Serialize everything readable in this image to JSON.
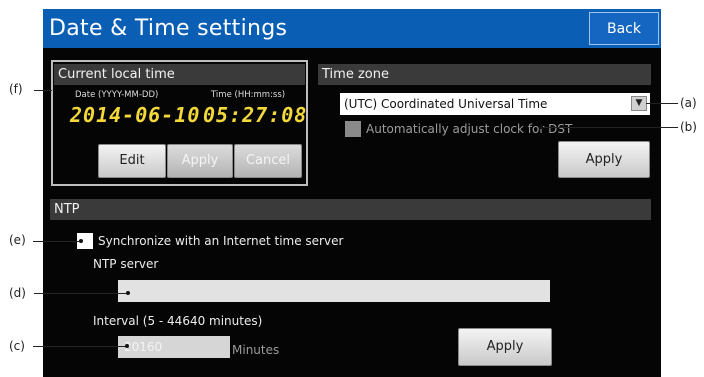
{
  "header": {
    "title": "Date & Time settings",
    "back_label": "Back"
  },
  "current_time": {
    "heading": "Current local time",
    "date_label": "Date (YYYY-MM-DD)",
    "time_label": "Time (HH:mm:ss)",
    "date_value": "2014-06-10",
    "time_value": "05:27:08",
    "edit_label": "Edit",
    "apply_label": "Apply",
    "cancel_label": "Cancel"
  },
  "timezone": {
    "heading": "Time zone",
    "selected": "(UTC) Coordinated Universal Time",
    "dst_label": "Automatically adjust clock for DST",
    "dst_checked": false,
    "apply_label": "Apply"
  },
  "ntp": {
    "heading": "NTP",
    "sync_label": "Synchronize with an Internet time server",
    "sync_checked": false,
    "server_label": "NTP server",
    "server_value": "",
    "interval_label": "Interval (5 - 44640 minutes)",
    "interval_value": "20160",
    "minutes_label": "Minutes",
    "apply_label": "Apply"
  },
  "callouts": {
    "a": "(a)",
    "b": "(b)",
    "c": "(c)",
    "d": "(d)",
    "e": "(e)",
    "f": "(f)"
  }
}
